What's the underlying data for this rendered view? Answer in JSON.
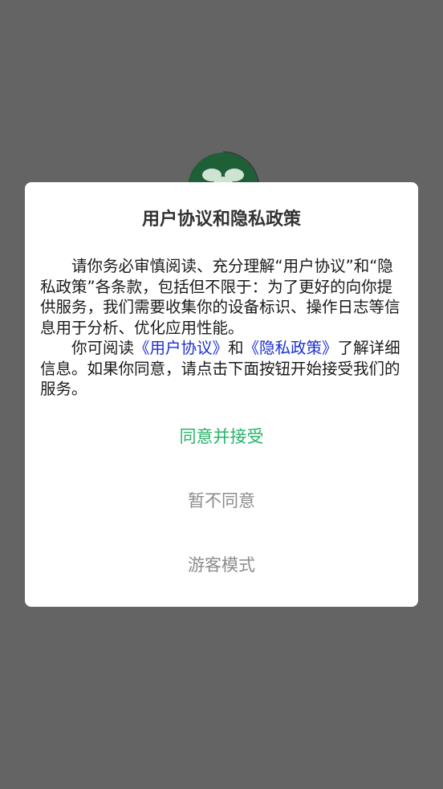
{
  "dialog": {
    "title": "用户协议和隐私政策",
    "paragraph1": "请你务必审慎阅读、充分理解“用户协议”和“隐私政策”各条款，包括但不限于：为了更好的向你提供服务，我们需要收集你的设备标识、操作日志等信息用于分析、优化应用性能。",
    "p2_prefix": "你可阅读",
    "p2_link_user": "《用户协议》",
    "p2_mid": "和",
    "p2_link_privacy": "《隐私政策》",
    "p2_suffix": "了解详细信息。如果你同意，请点击下面按钮开始接受我们的服务。",
    "agree_label": "同意并接受",
    "decline_label": "暂不同意",
    "guest_label": "游客模式"
  },
  "colors": {
    "overlay": "#646464",
    "accent_green": "#27b36a",
    "link_blue": "#1b2fd4",
    "logo_green": "#1f6b3e"
  },
  "icons": {
    "background_logo": "app-logo-icon"
  }
}
